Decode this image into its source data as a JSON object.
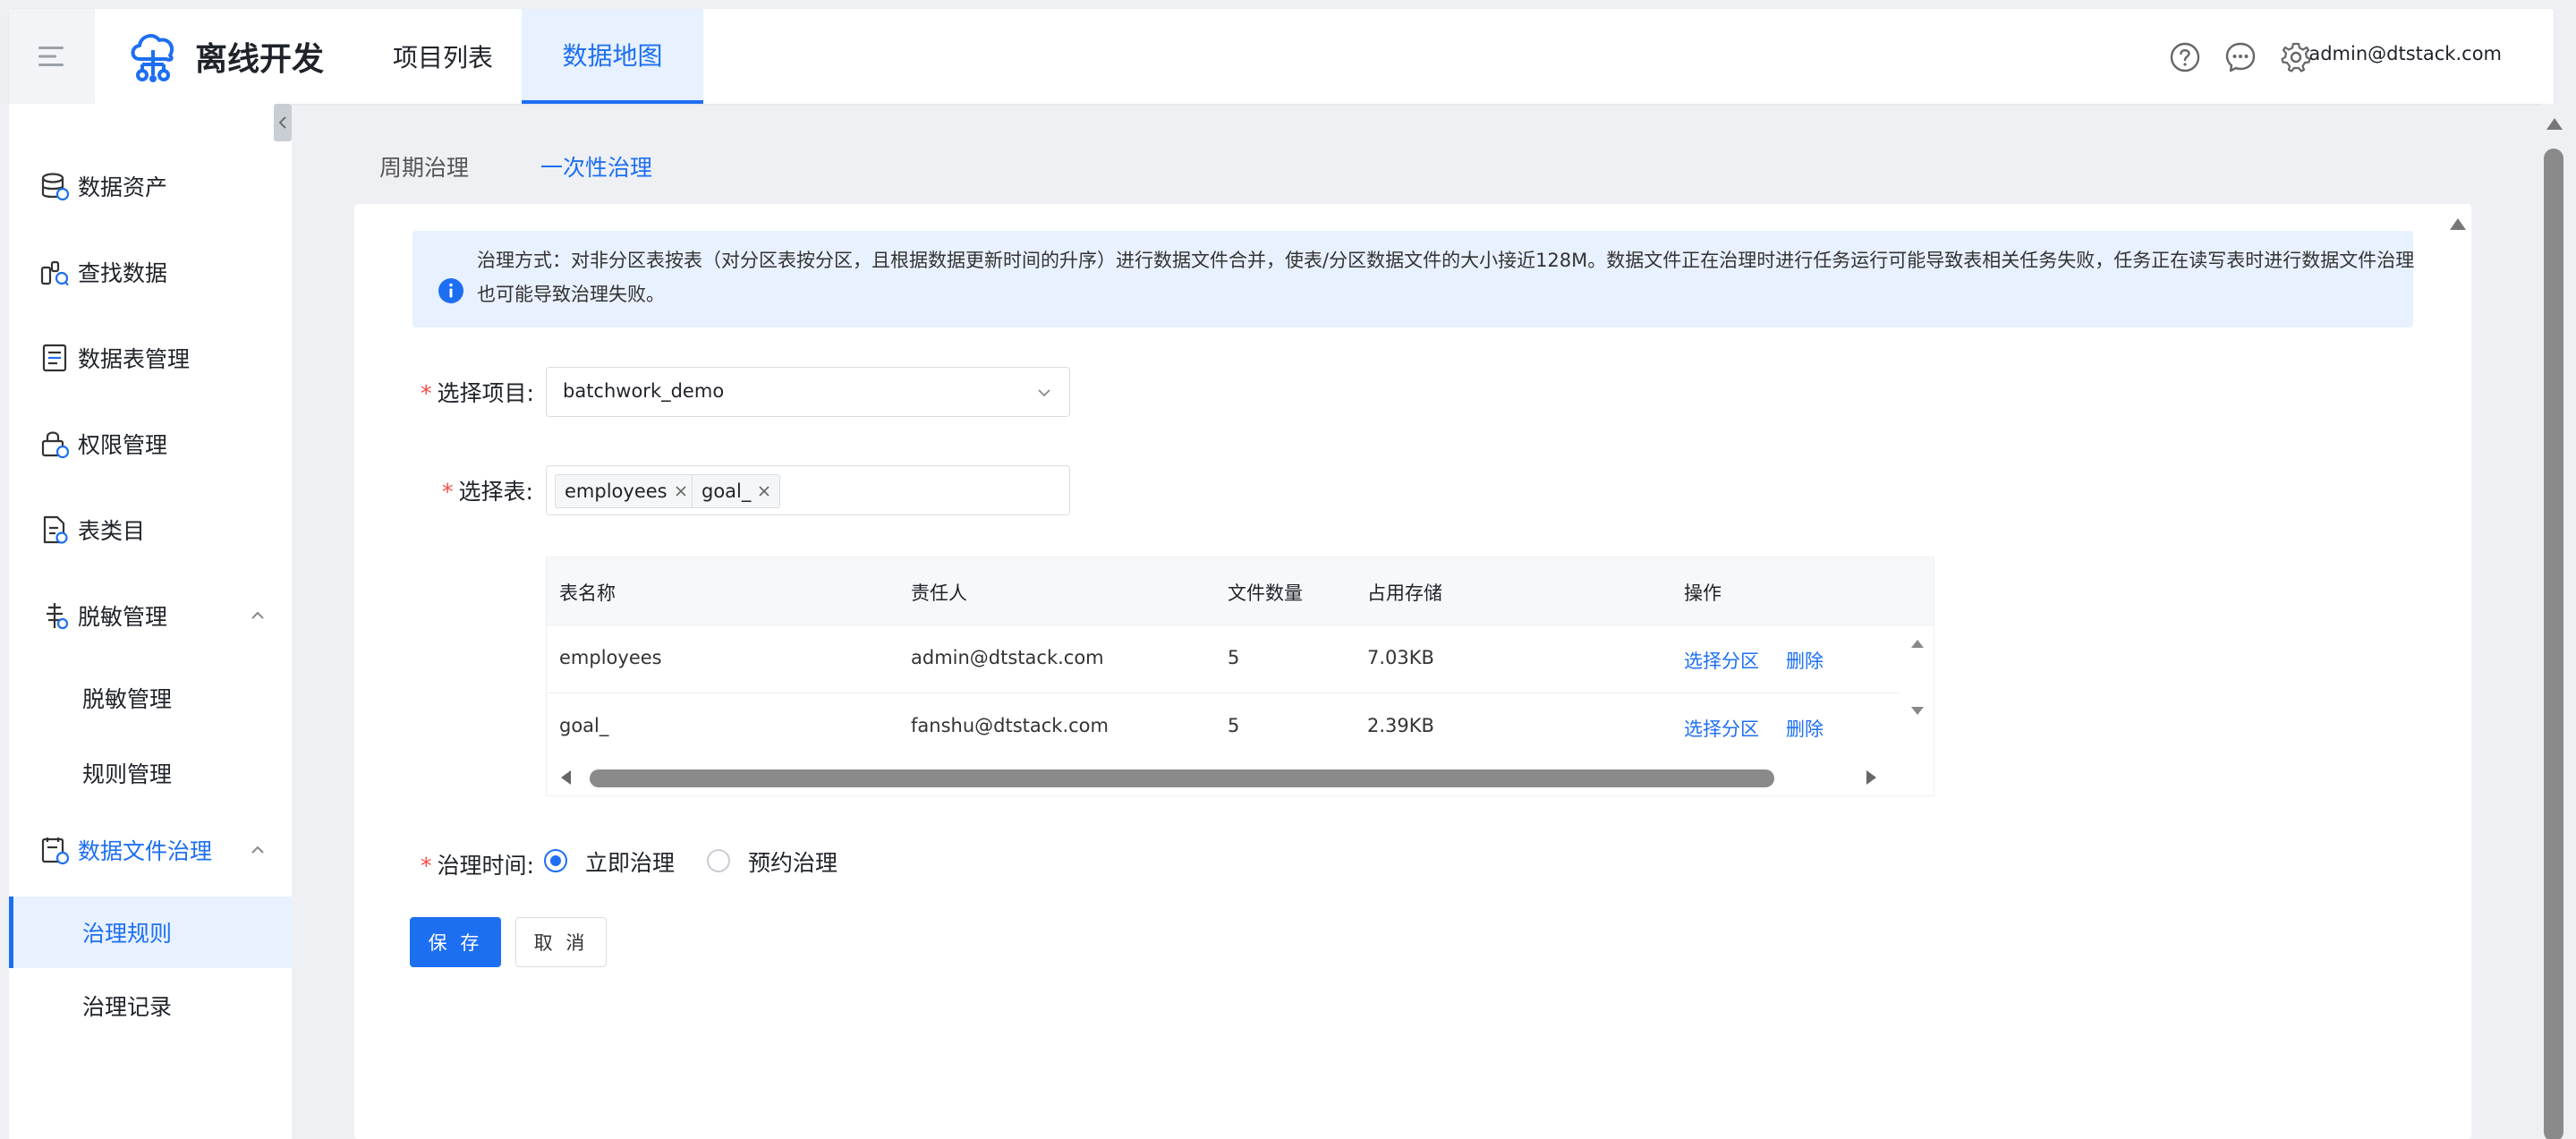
{
  "header": {
    "app_title": "离线开发",
    "nav": [
      {
        "label": "项目列表"
      },
      {
        "label": "数据地图"
      }
    ],
    "user": "admin@dtstack.com"
  },
  "sidebar": {
    "items": [
      {
        "label": "数据资产"
      },
      {
        "label": "查找数据"
      },
      {
        "label": "数据表管理"
      },
      {
        "label": "权限管理"
      },
      {
        "label": "表类目"
      },
      {
        "label": "脱敏管理"
      },
      {
        "label": "数据文件治理"
      }
    ],
    "desens_sub": [
      {
        "label": "脱敏管理"
      },
      {
        "label": "规则管理"
      }
    ],
    "governance_sub": [
      {
        "label": "治理规则"
      },
      {
        "label": "治理记录"
      }
    ]
  },
  "subtabs": [
    {
      "label": "周期治理"
    },
    {
      "label": "一次性治理"
    }
  ],
  "alert": {
    "line1": "治理方式：对非分区表按表（对分区表按分区，且根据数据更新时间的升序）进行数据文件合并，使表/分区数据文件的大小接近128M。数据文件正在治理时进行任务运行可能导致表相关任务失败，任务正在读写表时进行数据文件治理",
    "line2": "也可能导致治理失败。"
  },
  "form": {
    "required_mark": "*",
    "project_label": "选择项目:",
    "project_value": "batchwork_demo",
    "table_label": "选择表:",
    "tags": [
      "employees",
      "goal_"
    ],
    "time_label": "治理时间:",
    "radios": [
      {
        "label": "立即治理",
        "checked": true
      },
      {
        "label": "预约治理",
        "checked": false
      }
    ],
    "save_label": "保 存",
    "cancel_label": "取 消"
  },
  "table": {
    "columns": [
      "表名称",
      "责任人",
      "文件数量",
      "占用存储",
      "操作"
    ],
    "rows": [
      {
        "name": "employees",
        "owner": "admin@dtstack.com",
        "files": "5",
        "storage": "7.03KB",
        "op1": "选择分区",
        "op2": "删除"
      },
      {
        "name": "goal_",
        "owner": "fanshu@dtstack.com",
        "files": "5",
        "storage": "2.39KB",
        "op1": "选择分区",
        "op2": "删除"
      }
    ]
  },
  "colors": {
    "accent": "#1d6ff2",
    "required": "#f54a45",
    "active_bg": "#e8f1ff"
  }
}
